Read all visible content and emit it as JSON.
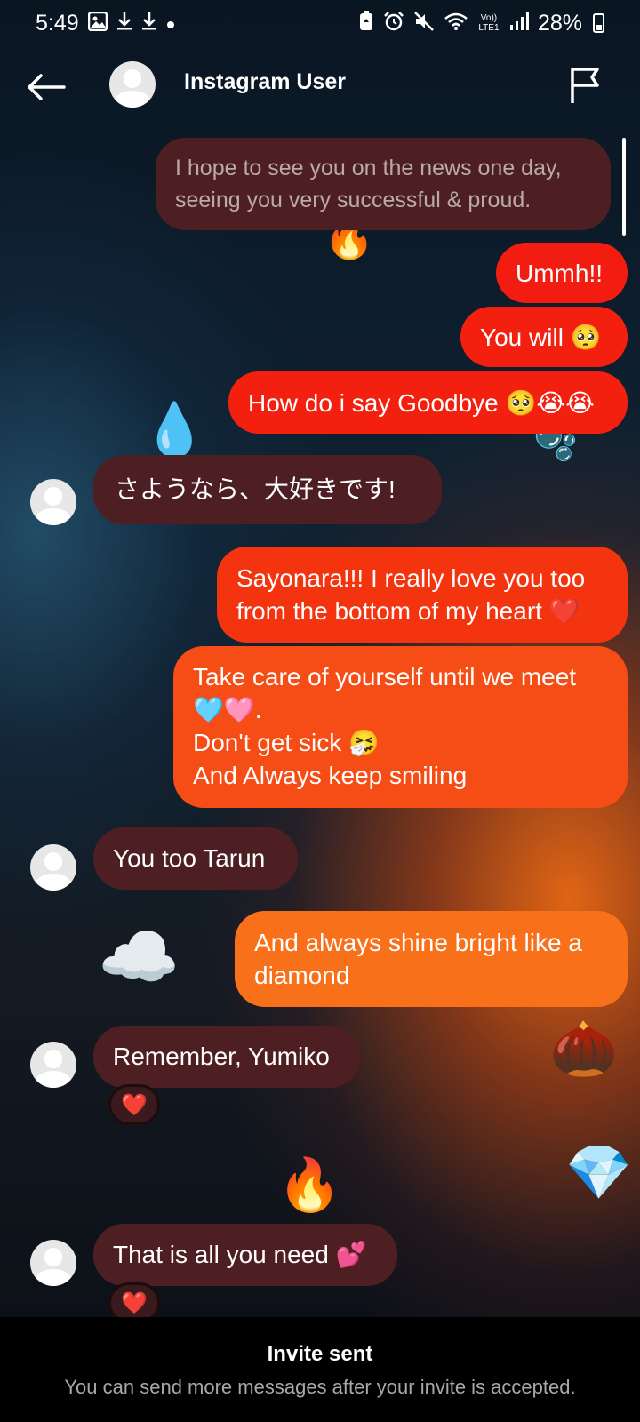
{
  "status_bar": {
    "time": "5:49",
    "battery": "28%",
    "left_icons": [
      "image-icon",
      "download-icon",
      "download-icon",
      "dot-icon"
    ],
    "right_icons": [
      "battery-saver-icon",
      "alarm-icon",
      "mute-icon",
      "wifi-icon",
      "volte-icon",
      "signal-icon"
    ],
    "volte_text": "Vo)) LTE1"
  },
  "header": {
    "title": "Instagram User",
    "back_icon": "back-arrow-icon",
    "flag_icon": "flag-icon"
  },
  "messages": [
    {
      "side": "in",
      "text": "I hope to see you on the news one day,\nseeing you very successful & proud."
    },
    {
      "side": "out",
      "text": "Ummh!!"
    },
    {
      "side": "out",
      "text": "You will 🥺"
    },
    {
      "side": "out",
      "text": "How do i say Goodbye 🥺😭😭"
    },
    {
      "side": "in",
      "text": "さようなら、大好きです!"
    },
    {
      "side": "out",
      "text": "Sayonara!!! I really love you too\nfrom the bottom of my heart ❤️"
    },
    {
      "side": "out",
      "text": "Take care of yourself until we meet\n🩵🩷.\nDon't get sick 🤧\nAnd Always keep smiling"
    },
    {
      "side": "in",
      "text": "You too Tarun"
    },
    {
      "side": "out",
      "text": "And always shine bright like a\ndiamond"
    },
    {
      "side": "in",
      "text": "Remember, Yumiko",
      "reaction": "❤️"
    },
    {
      "side": "out",
      "text": "💎"
    },
    {
      "side": "in",
      "text": "That is all you need 💕",
      "reaction": "❤️"
    }
  ],
  "stickers": [
    "🔥",
    "🔥",
    "💧",
    "🫧",
    "☁️",
    "🌰"
  ],
  "footer": {
    "title": "Invite sent",
    "subtitle": "You can send more messages after your invite is accepted."
  },
  "colors": {
    "bubble_in": "#4d1f22",
    "bubble_out_top": "#f42414",
    "bubble_out_bottom": "#fb7016",
    "footer_bg": "#000000"
  }
}
